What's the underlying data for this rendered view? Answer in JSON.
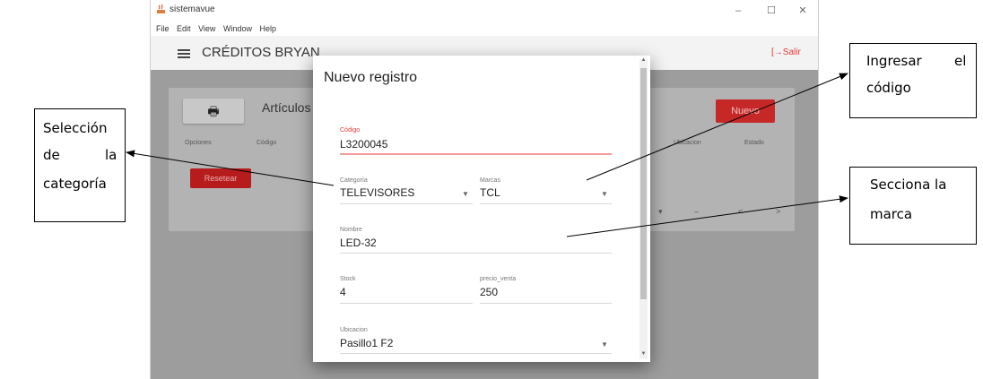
{
  "window": {
    "title": "sistemavue",
    "menu": [
      "File",
      "Edit",
      "View",
      "Window",
      "Help"
    ],
    "controls": {
      "minimize": "–",
      "maximize": "☐",
      "close": "✕"
    }
  },
  "toolbar": {
    "app_name": "CRÉDITOS BRYAN",
    "exit_label": "Salir"
  },
  "card": {
    "title": "Artículos",
    "new_button": "Nuevo",
    "columns": [
      "Opciones",
      "Código",
      "Ubicacion",
      "Estado"
    ],
    "reset_button": "Resetear",
    "pager_prev": "<",
    "pager_next": ">",
    "pager_dash": "–"
  },
  "dialog": {
    "title": "Nuevo registro",
    "codigo": {
      "label": "Código",
      "value": "L3200045"
    },
    "categoria": {
      "label": "Categoría",
      "value": "TELEVISORES"
    },
    "marcas": {
      "label": "Marcas",
      "value": "TCL"
    },
    "nombre": {
      "label": "Nombre",
      "value": "LED-32"
    },
    "stock": {
      "label": "Stock",
      "value": "4"
    },
    "precio": {
      "label": "precio_venta",
      "value": "250"
    },
    "ubicacion": {
      "label": "Ubicacion",
      "value": "Pasillo1 F2"
    }
  },
  "annotations": {
    "categoria": [
      "Selección",
      "de",
      "la",
      "categoría"
    ],
    "codigo": [
      "Ingresar",
      "el",
      "código"
    ],
    "marca": [
      "Secciona la",
      "marca"
    ]
  },
  "colors": {
    "accent": "#c62828",
    "error": "#e53935",
    "overlay": "#9d9d9d"
  }
}
